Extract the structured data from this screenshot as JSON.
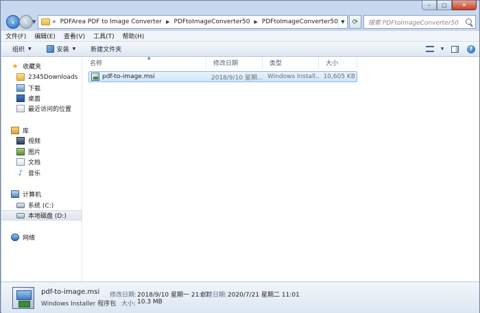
{
  "window": {
    "minimize": "–",
    "maximize": "□",
    "close": "✕"
  },
  "nav": {
    "back": "‹",
    "forward": "›",
    "breadcrumb_chevron": "«",
    "breadcrumb": [
      "PDFArea PDF to Image Converter",
      "PDFtoImageConverter50",
      "PDFtoImageConverter50"
    ],
    "search_placeholder": "搜索 PDFtoImageConverter50"
  },
  "menu": [
    "文件(F)",
    "编辑(E)",
    "查看(V)",
    "工具(T)",
    "帮助(H)"
  ],
  "toolbar": {
    "organize": "组织",
    "install": "安装",
    "new_folder": "新建文件夹",
    "help": "?"
  },
  "navpane": {
    "favorites": "收藏夹",
    "favorites_items": [
      "2345Downloads",
      "下载",
      "桌面",
      "最近访问的位置"
    ],
    "libraries": "库",
    "libraries_items": [
      "视频",
      "图片",
      "文档",
      "音乐"
    ],
    "computer": "计算机",
    "computer_items": [
      "系统 (C:)",
      "本地磁盘 (D:)"
    ],
    "network": "网络"
  },
  "columns": {
    "name": "名称",
    "date": "修改日期",
    "type": "类型",
    "size": "大小"
  },
  "files": [
    {
      "name": "pdf-to-image.msi",
      "date": "2018/9/10 星期...",
      "type": "Windows Install...",
      "size": "10,605 KB"
    }
  ],
  "details": {
    "name": "pdf-to-image.msi",
    "type": "Windows Installer 程序包",
    "modified_label": "修改日期:",
    "modified_value": "2018/9/10 星期一 21:07",
    "created_label": "创建日期:",
    "created_value": "2020/7/21 星期二 11:01",
    "size_label": "大小:",
    "size_value": "10.3 MB"
  }
}
